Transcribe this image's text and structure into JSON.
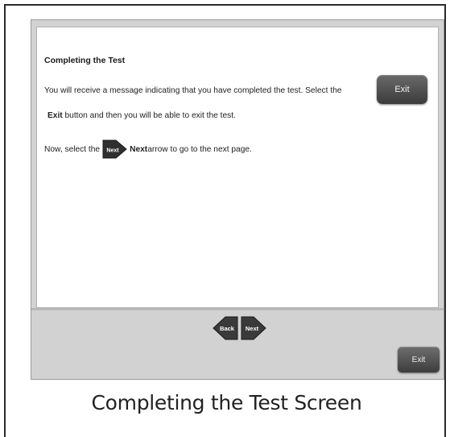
{
  "content": {
    "heading": "Completing the Test",
    "line1_text": "You will receive a message indicating that you have completed the test. Select the",
    "line2_bold": "Exit",
    "line2_text": " button and then you will be able to exit the test.",
    "line3_prefix": "Now, select the",
    "line3_bold": "Next",
    "line3_suffix": " arrow to go to the next page.",
    "exit_inline_label": "Exit",
    "next_inline_label": "Next"
  },
  "nav": {
    "back_label": "Back",
    "next_label": "Next"
  },
  "footer": {
    "exit_label": "Exit"
  },
  "caption": "Completing the Test Screen",
  "colors": {
    "button_dark": "#3b3b3b",
    "panel_gray": "#d2d2d2"
  }
}
